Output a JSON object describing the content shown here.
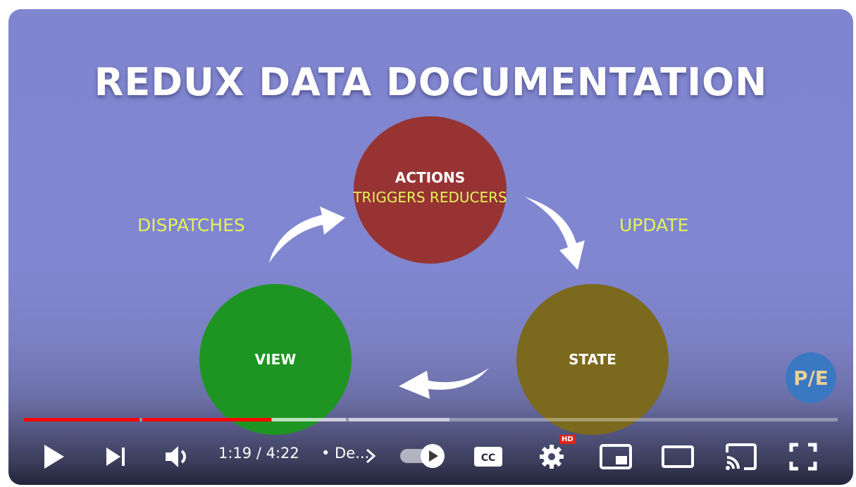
{
  "video": {
    "title": "REDUX DATA DOCUMENTATION",
    "diagram": {
      "actions_label": "ACTIONS",
      "actions_sub": "TRIGGERS REDUCERS",
      "view_label": "VIEW",
      "state_label": "STATE",
      "dispatches_label": "DISPATCHES",
      "update_label": "UPDATE"
    },
    "channel_badge": "P/E"
  },
  "colors": {
    "actions": "#973433",
    "view": "#1e9522",
    "state": "#7b691d",
    "highlight_text": "#e4f25a",
    "progress_played": "#ff0000"
  },
  "player": {
    "current_time": "1:19",
    "duration": "4:22",
    "time_display": "1:19 / 4:22",
    "chapter_title": "• De...",
    "progress_played_fraction": 0.3,
    "autoplay": true,
    "quality_badge": "HD",
    "icons": [
      "play-icon",
      "next-icon",
      "volume-icon",
      "chevron-right-icon",
      "autoplay-toggle",
      "cc-icon",
      "settings-icon",
      "miniplayer-icon",
      "theater-icon",
      "cast-icon",
      "fullscreen-icon"
    ],
    "cc_label": "CC"
  }
}
